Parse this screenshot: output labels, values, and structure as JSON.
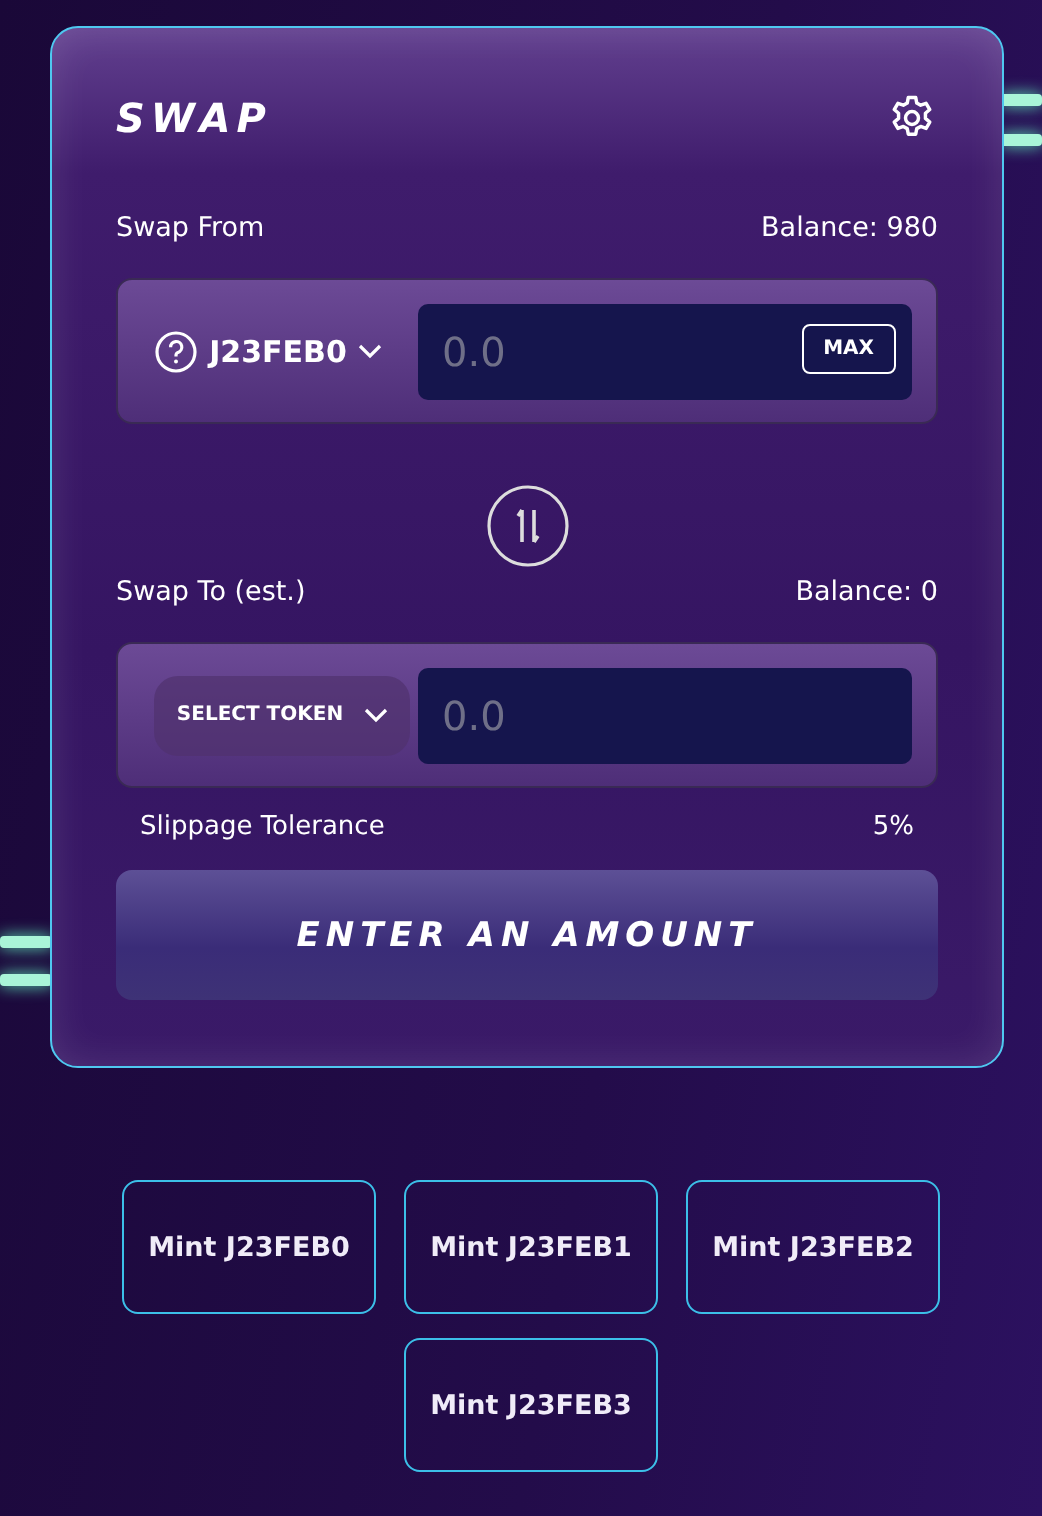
{
  "swap": {
    "title": "SWAP",
    "from": {
      "label": "Swap From",
      "balance": "Balance: 980",
      "token": "J23FEB0",
      "placeholder": "0.0",
      "max_button": "MAX"
    },
    "to": {
      "label": "Swap To (est.)",
      "balance": "Balance: 0",
      "token_button": "SELECT TOKEN",
      "placeholder": "0.0"
    },
    "slippage": {
      "label": "Slippage Tolerance",
      "value": "5%"
    },
    "submit_button": "ENTER AN AMOUNT"
  },
  "mint_buttons": [
    "Mint J23FEB0",
    "Mint J23FEB1",
    "Mint J23FEB2",
    "Mint J23FEB3"
  ]
}
